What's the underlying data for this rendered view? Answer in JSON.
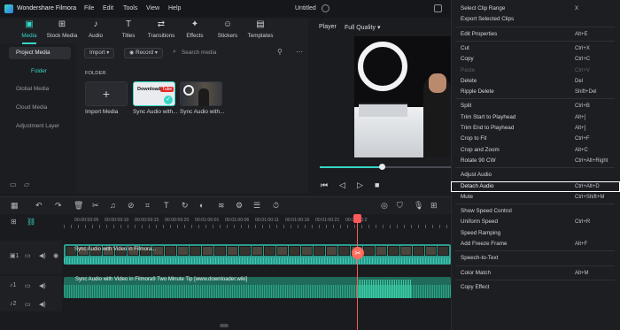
{
  "titlebar": {
    "app": "Wondershare Filmora",
    "menus": [
      "File",
      "Edit",
      "Tools",
      "View",
      "Help"
    ],
    "project": "Untitled"
  },
  "toolbar": {
    "tabs": [
      {
        "label": "Media",
        "icon": "media-icon"
      },
      {
        "label": "Stock Media",
        "icon": "stock-media-icon"
      },
      {
        "label": "Audio",
        "icon": "audio-icon"
      },
      {
        "label": "Titles",
        "icon": "titles-icon"
      },
      {
        "label": "Transitions",
        "icon": "transitions-icon"
      },
      {
        "label": "Effects",
        "icon": "effects-icon"
      },
      {
        "label": "Stickers",
        "icon": "stickers-icon"
      },
      {
        "label": "Templates",
        "icon": "templates-icon"
      }
    ],
    "active": "Media"
  },
  "sidebar": {
    "items": [
      "Project Media",
      "Global Media",
      "Cloud Media",
      "Adjustment Layer"
    ],
    "folder": "Folder"
  },
  "media": {
    "import": "Import",
    "record": "Record",
    "search_placeholder": "Search media",
    "folder_label": "FOLDER",
    "items": [
      {
        "label": "Import Media"
      },
      {
        "label": "Sync Audio with...",
        "badge": "Download",
        "badge2": "Tube"
      },
      {
        "label": "Sync Audio with..."
      }
    ]
  },
  "player": {
    "label": "Player",
    "quality": "Full Quality"
  },
  "timeline": {
    "ruler": [
      "00:00:59:05",
      "00:00:59:10",
      "00:00:59:15",
      "00:00:59:20",
      "00:01:00:01",
      "00:01:00:06",
      "00:01:00:11",
      "00:01:00:16",
      "00:01:00:21",
      "00:01:00:2"
    ],
    "tracks": [
      {
        "num": "1",
        "type": "video"
      },
      {
        "num": "1",
        "type": "audio"
      },
      {
        "num": "2",
        "type": "audio"
      }
    ],
    "video_clip": "Sync Audio with Video in Filmora...",
    "audio_clip": "Sync Audio with Video in Filmora9 Two Minute Tip [www.downloader.wiki]"
  },
  "context_menu": {
    "items": [
      {
        "label": "Select Clip Range",
        "shortcut": "X"
      },
      {
        "label": "Export Selected Clips",
        "shortcut": ""
      },
      {
        "sep": true
      },
      {
        "label": "Edit Properties",
        "shortcut": "Alt+E"
      },
      {
        "sep": true
      },
      {
        "label": "Cut",
        "shortcut": "Ctrl+X"
      },
      {
        "label": "Copy",
        "shortcut": "Ctrl+C"
      },
      {
        "label": "Paste",
        "shortcut": "Ctrl+V",
        "disabled": true
      },
      {
        "label": "Delete",
        "shortcut": "Del"
      },
      {
        "label": "Ripple Delete",
        "shortcut": "Shift+Del"
      },
      {
        "sep": true
      },
      {
        "label": "Split",
        "shortcut": "Ctrl+B"
      },
      {
        "label": "Trim Start to Playhead",
        "shortcut": "Alt+["
      },
      {
        "label": "Trim End to Playhead",
        "shortcut": "Alt+]"
      },
      {
        "label": "Crop to Fit",
        "shortcut": "Ctrl+F"
      },
      {
        "label": "Crop and Zoom",
        "shortcut": "Alt+C"
      },
      {
        "label": "Rotate 90 CW",
        "shortcut": "Ctrl+Alt+Right"
      },
      {
        "sep": true
      },
      {
        "label": "Adjust Audio",
        "shortcut": ""
      },
      {
        "label": "Detach Audio",
        "shortcut": "Ctrl+Alt+D",
        "highlight": true
      },
      {
        "label": "Mute",
        "shortcut": "Ctrl+Shift+M"
      },
      {
        "sep": true
      },
      {
        "label": "Show Speed Control",
        "shortcut": ""
      },
      {
        "label": "Uniform Speed",
        "shortcut": "Ctrl+R"
      },
      {
        "label": "Speed Ramping",
        "shortcut": ""
      },
      {
        "label": "Add Freeze Frame",
        "shortcut": "Alt+F"
      },
      {
        "sep": true
      },
      {
        "label": "Speech-to-Text",
        "shortcut": ""
      },
      {
        "sep": true
      },
      {
        "label": "Color Match",
        "shortcut": "Alt+M"
      },
      {
        "sep": true
      },
      {
        "label": "Copy Effect",
        "shortcut": ""
      }
    ]
  },
  "colors": {
    "accent": "#35d7c6",
    "video_clip": "#2a9b8d",
    "audio_clip": "#1f6a58",
    "playhead": "#ff5a5a"
  }
}
